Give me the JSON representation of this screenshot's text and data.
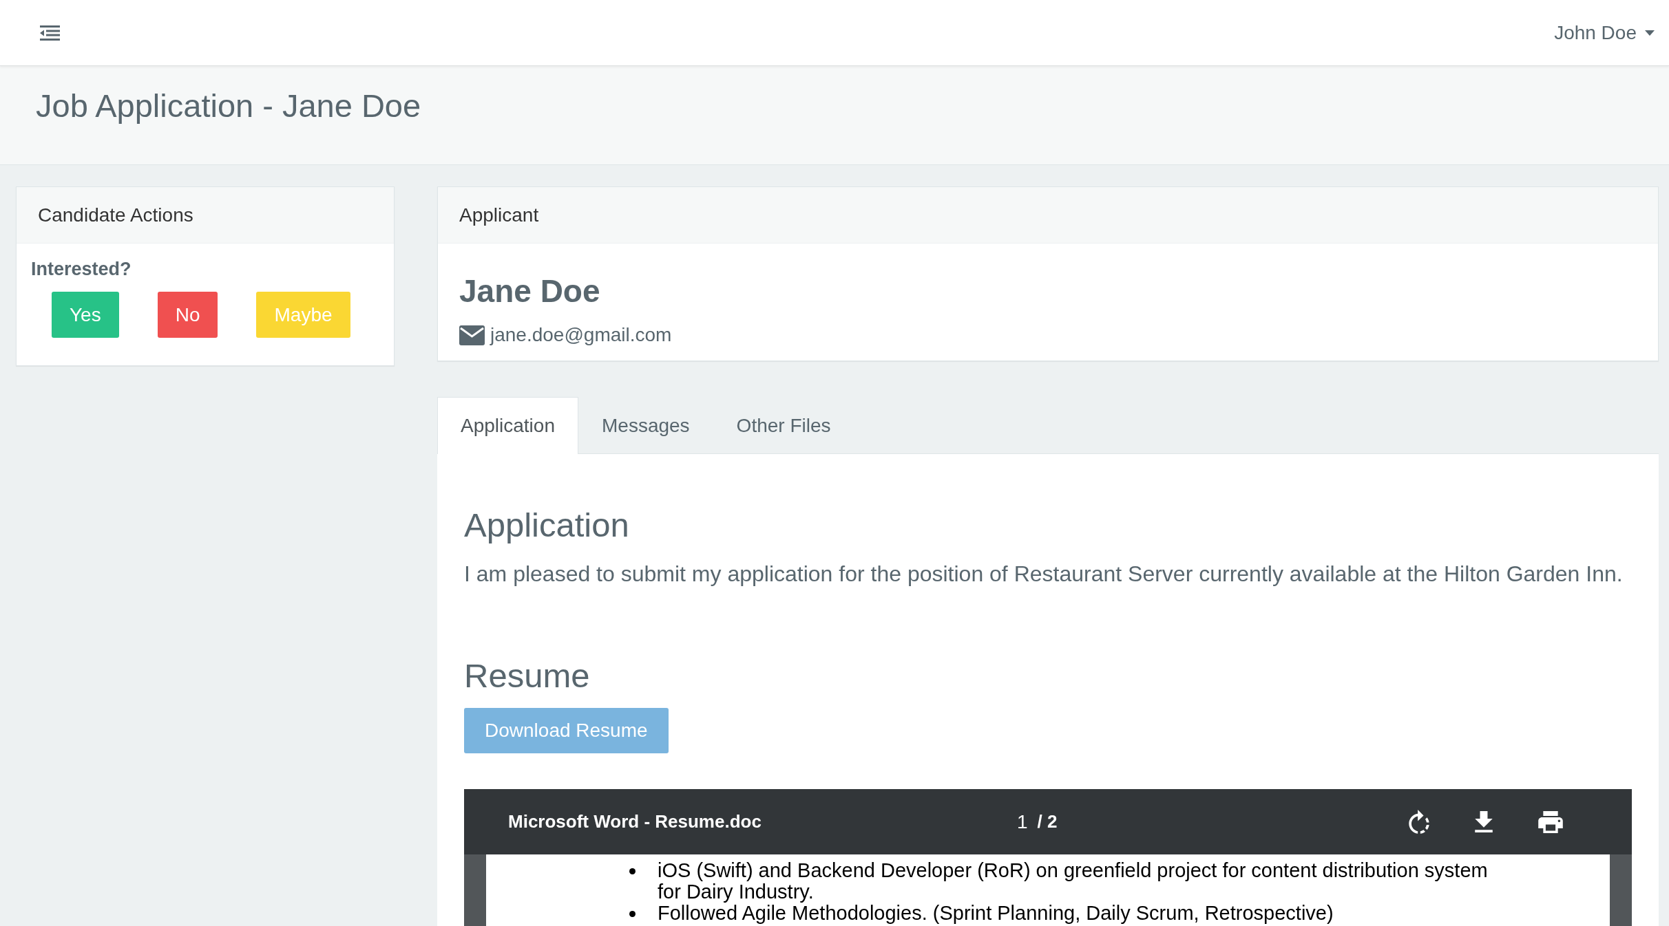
{
  "navbar": {
    "user_menu": {
      "label": "John Doe"
    }
  },
  "page_header": {
    "title": "Job Application - Jane Doe"
  },
  "candidate_actions": {
    "title": "Candidate Actions",
    "question": "Interested?",
    "buttons": [
      {
        "label": "Yes",
        "color": "#27c287"
      },
      {
        "label": "No",
        "color": "#f05050"
      },
      {
        "label": "Maybe",
        "color": "#fad733"
      }
    ]
  },
  "applicant": {
    "title": "Applicant",
    "name": "Jane Doe",
    "email": "jane.doe@gmail.com"
  },
  "tabs": [
    {
      "label": "Application",
      "selected": true
    },
    {
      "label": "Messages",
      "selected": false
    },
    {
      "label": "Other Files",
      "selected": false
    }
  ],
  "application": {
    "heading": "Application",
    "text": "I am pleased to submit my application for the position of Restaurant Server currently available at the Hilton Garden Inn."
  },
  "resume": {
    "heading": "Resume",
    "download_button": "Download Resume",
    "viewer": {
      "title": "Microsoft Word - Resume.doc",
      "page_number": "1",
      "page_total": "/ 2",
      "items": [
        {
          "text": "iOS (Swift) and Backend Developer (RoR) on greenfield project for content distribution system for Dairy Industry."
        },
        {
          "text": "Followed Agile Methodologies. (Sprint Planning, Daily Scrum, Retrospective)"
        }
      ]
    }
  }
}
